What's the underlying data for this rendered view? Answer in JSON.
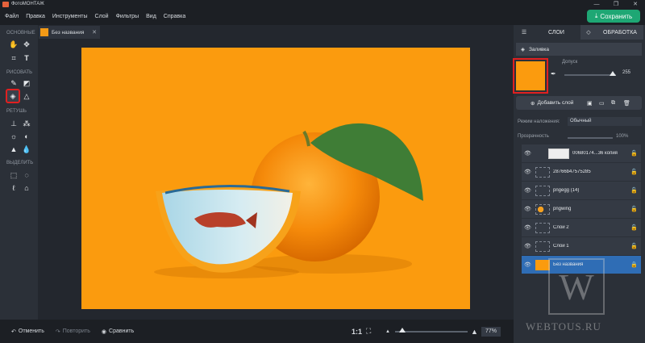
{
  "app": {
    "title": "ФотоМОНТАЖ"
  },
  "window_controls": [
    "—",
    "❐",
    "✕"
  ],
  "menu": [
    "Файл",
    "Правка",
    "Инструменты",
    "Слой",
    "Фильтры",
    "Вид",
    "Справка"
  ],
  "save_button": "Сохранить",
  "left_panel": {
    "sections": [
      "ОСНОВНЫЕ",
      "РИСОВАТЬ",
      "РЕТУШЬ",
      "ВЫДЕЛИТЬ"
    ],
    "selected_tool": "fill-tool"
  },
  "document_tab": {
    "name": "Без названия",
    "close": "✕"
  },
  "right_panel": {
    "tabs": [
      "СЛОИ",
      "ОБРАБОТКА"
    ],
    "fill_label": "Заливка",
    "fill_color": "#fb9b0e",
    "tolerance_label": "Допуск",
    "tolerance_value": "255",
    "add_layer": "Добавить слой",
    "blend_label": "Режим наложения:",
    "blend_value": "Обычный",
    "opacity_label": "Прозрачность",
    "opacity_value": "100%",
    "layers": [
      {
        "name": "00680174...36 копия",
        "active": false
      },
      {
        "name": "28766b47575285",
        "active": false
      },
      {
        "name": "pngegg (14)",
        "active": false
      },
      {
        "name": "pngwing",
        "active": false
      },
      {
        "name": "Слой 2",
        "active": false
      },
      {
        "name": "Слой 1",
        "active": false
      },
      {
        "name": "Без названия",
        "active": true
      }
    ]
  },
  "bottom_bar": {
    "undo": "Отменить",
    "redo": "Повторить",
    "compare": "Сравнить",
    "ratio": "1:1",
    "zoom": "77%"
  },
  "watermark": {
    "letter": "W",
    "text": "WEBTOUS.RU"
  }
}
